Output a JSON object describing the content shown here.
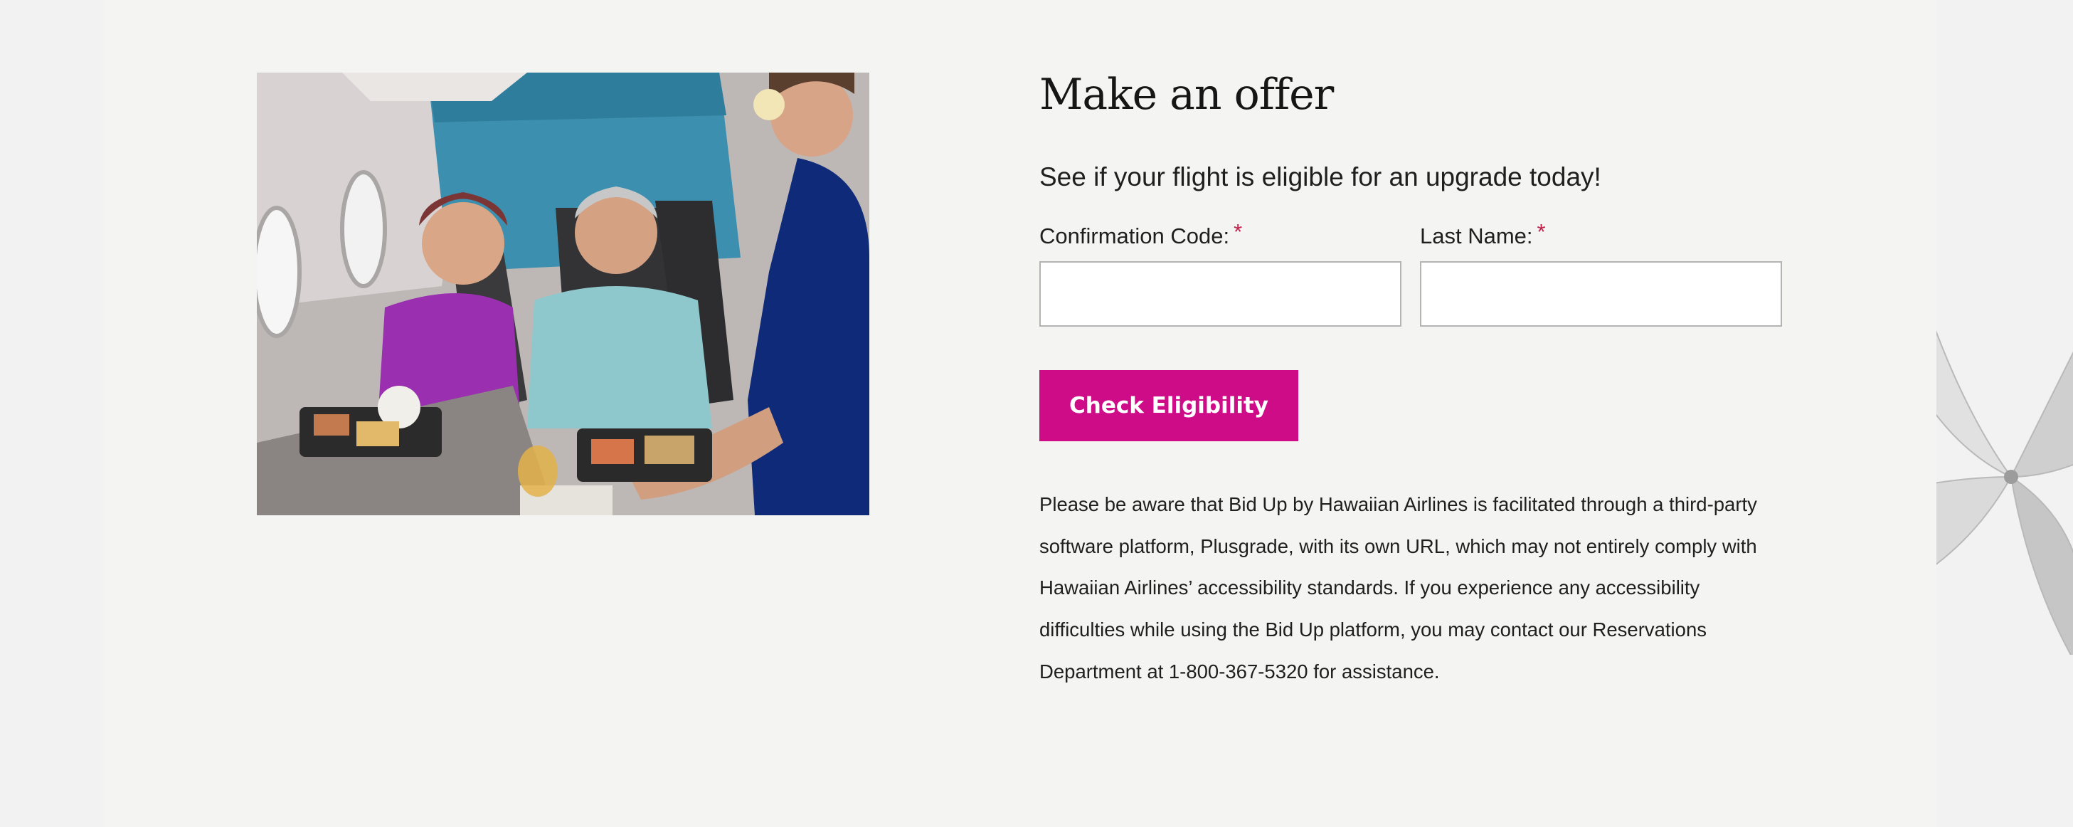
{
  "offer": {
    "title": "Make an offer",
    "subtitle": "See if your flight is eligible for an upgrade today!"
  },
  "form": {
    "confirmation_label": "Confirmation Code:",
    "last_name_label": "Last Name:",
    "required_marker": "*",
    "confirmation_value": "",
    "last_name_value": "",
    "submit_label": "Check Eligibility"
  },
  "disclaimer": "Please be aware that Bid Up by Hawaiian Airlines is facilitated through a third-party software platform, Plusgrade, with its own URL, which may not entirely comply with Hawaiian Airlines’ accessibility standards. If you experience any accessibility difficulties while using the Bid Up platform, you may contact our Reservations Department at 1-800-367-5320 for assistance.",
  "colors": {
    "accent": "#ce0c88",
    "required": "#c51f4c",
    "page_background": "#f1f2f1",
    "panel_background": "#f4f4f2"
  },
  "images": {
    "hero_photo": "cabin-photo-passengers-and-flight-attendant",
    "side_decoration": "plumeria-flower"
  }
}
